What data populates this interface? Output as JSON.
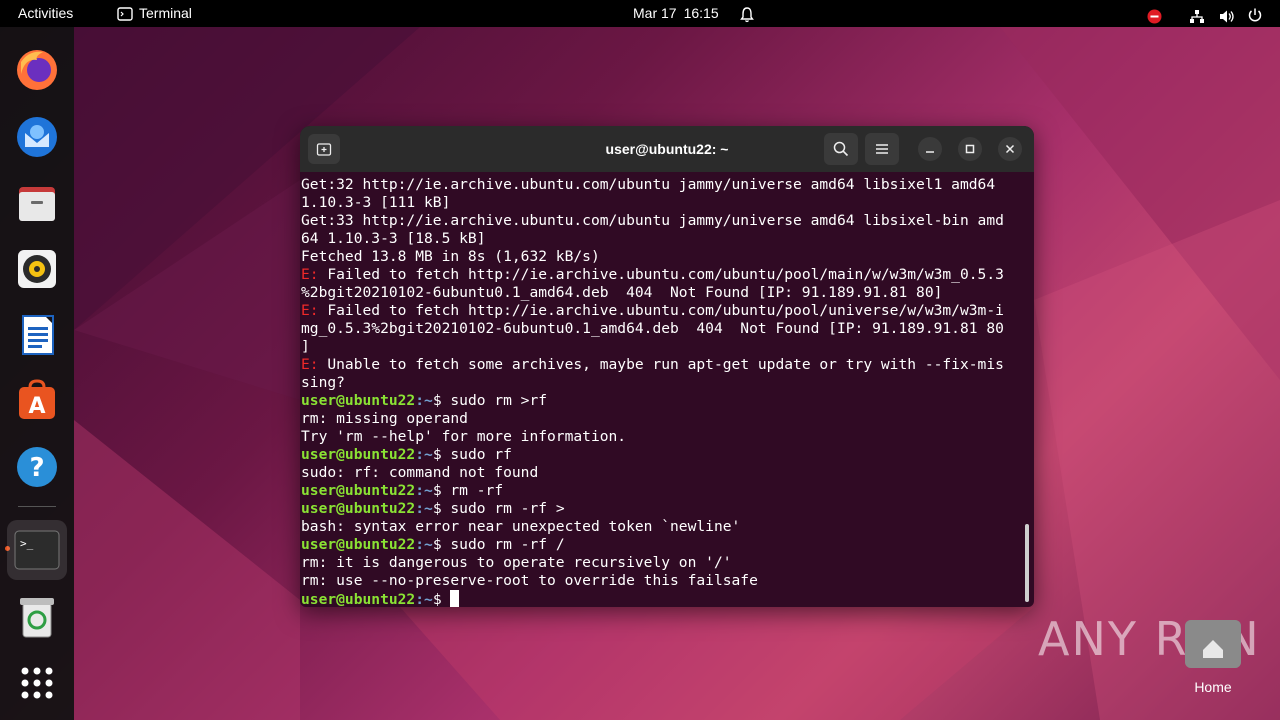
{
  "topbar": {
    "activities": "Activities",
    "app_name": "Terminal",
    "date": "Mar 17",
    "time": "16:15"
  },
  "dock": {
    "apps": [
      {
        "name": "firefox",
        "icon": "firefox-icon"
      },
      {
        "name": "thunderbird",
        "icon": "thunderbird-icon"
      },
      {
        "name": "files",
        "icon": "files-icon"
      },
      {
        "name": "rhythmbox",
        "icon": "rhythmbox-icon"
      },
      {
        "name": "writer",
        "icon": "libreoffice-writer-icon"
      },
      {
        "name": "app-center",
        "icon": "app-center-icon"
      },
      {
        "name": "help",
        "icon": "help-icon"
      },
      {
        "name": "terminal",
        "icon": "terminal-icon",
        "running": true
      },
      {
        "name": "trash",
        "icon": "trash-icon"
      },
      {
        "name": "show-apps",
        "icon": "grid-icon"
      }
    ]
  },
  "window": {
    "title": "user@ubuntu22: ~"
  },
  "terminal": {
    "lines": [
      {
        "type": "plain",
        "text": "Get:32 http://ie.archive.ubuntu.com/ubuntu jammy/universe amd64 libsixel1 amd64"
      },
      {
        "type": "plain",
        "text": "1.10.3-3 [111 kB]"
      },
      {
        "type": "plain",
        "text": "Get:33 http://ie.archive.ubuntu.com/ubuntu jammy/universe amd64 libsixel-bin amd"
      },
      {
        "type": "plain",
        "text": "64 1.10.3-3 [18.5 kB]"
      },
      {
        "type": "plain",
        "text": "Fetched 13.8 MB in 8s (1,632 kB/s)"
      },
      {
        "type": "error",
        "label": "E:",
        "text": " Failed to fetch http://ie.archive.ubuntu.com/ubuntu/pool/main/w/w3m/w3m_0.5.3"
      },
      {
        "type": "plain",
        "text": "%2bgit20210102-6ubuntu0.1_amd64.deb  404  Not Found [IP: 91.189.91.81 80]"
      },
      {
        "type": "error",
        "label": "E:",
        "text": " Failed to fetch http://ie.archive.ubuntu.com/ubuntu/pool/universe/w/w3m/w3m-i"
      },
      {
        "type": "plain",
        "text": "mg_0.5.3%2bgit20210102-6ubuntu0.1_amd64.deb  404  Not Found [IP: 91.189.91.81 80"
      },
      {
        "type": "plain",
        "text": "]"
      },
      {
        "type": "error",
        "label": "E:",
        "text": " Unable to fetch some archives, maybe run apt-get update or try with --fix-mis"
      },
      {
        "type": "plain",
        "text": "sing?"
      },
      {
        "type": "prompt",
        "user": "user@ubuntu22",
        "path": ":~",
        "cmd": "$ sudo rm >rf"
      },
      {
        "type": "plain",
        "text": "rm: missing operand"
      },
      {
        "type": "plain",
        "text": "Try 'rm --help' for more information."
      },
      {
        "type": "prompt",
        "user": "user@ubuntu22",
        "path": ":~",
        "cmd": "$ sudo rf"
      },
      {
        "type": "plain",
        "text": "sudo: rf: command not found"
      },
      {
        "type": "prompt",
        "user": "user@ubuntu22",
        "path": ":~",
        "cmd": "$ rm -rf"
      },
      {
        "type": "prompt",
        "user": "user@ubuntu22",
        "path": ":~",
        "cmd": "$ sudo rm -rf >"
      },
      {
        "type": "plain",
        "text": "bash: syntax error near unexpected token `newline'"
      },
      {
        "type": "prompt",
        "user": "user@ubuntu22",
        "path": ":~",
        "cmd": "$ sudo rm -rf /"
      },
      {
        "type": "plain",
        "text": "rm: it is dangerous to operate recursively on '/'"
      },
      {
        "type": "plain",
        "text": "rm: use --no-preserve-root to override this failsafe"
      },
      {
        "type": "current",
        "user": "user@ubuntu22",
        "path": ":~",
        "cmd": "$ "
      }
    ]
  },
  "desktop": {
    "watermark": "ANY RUN",
    "home_label": "Home"
  },
  "colors": {
    "terminal_bg": "#300a24",
    "prompt_green": "#8ae234",
    "path_blue": "#729fcf",
    "error_red": "#ef2929",
    "accent_orange": "#e95420"
  }
}
